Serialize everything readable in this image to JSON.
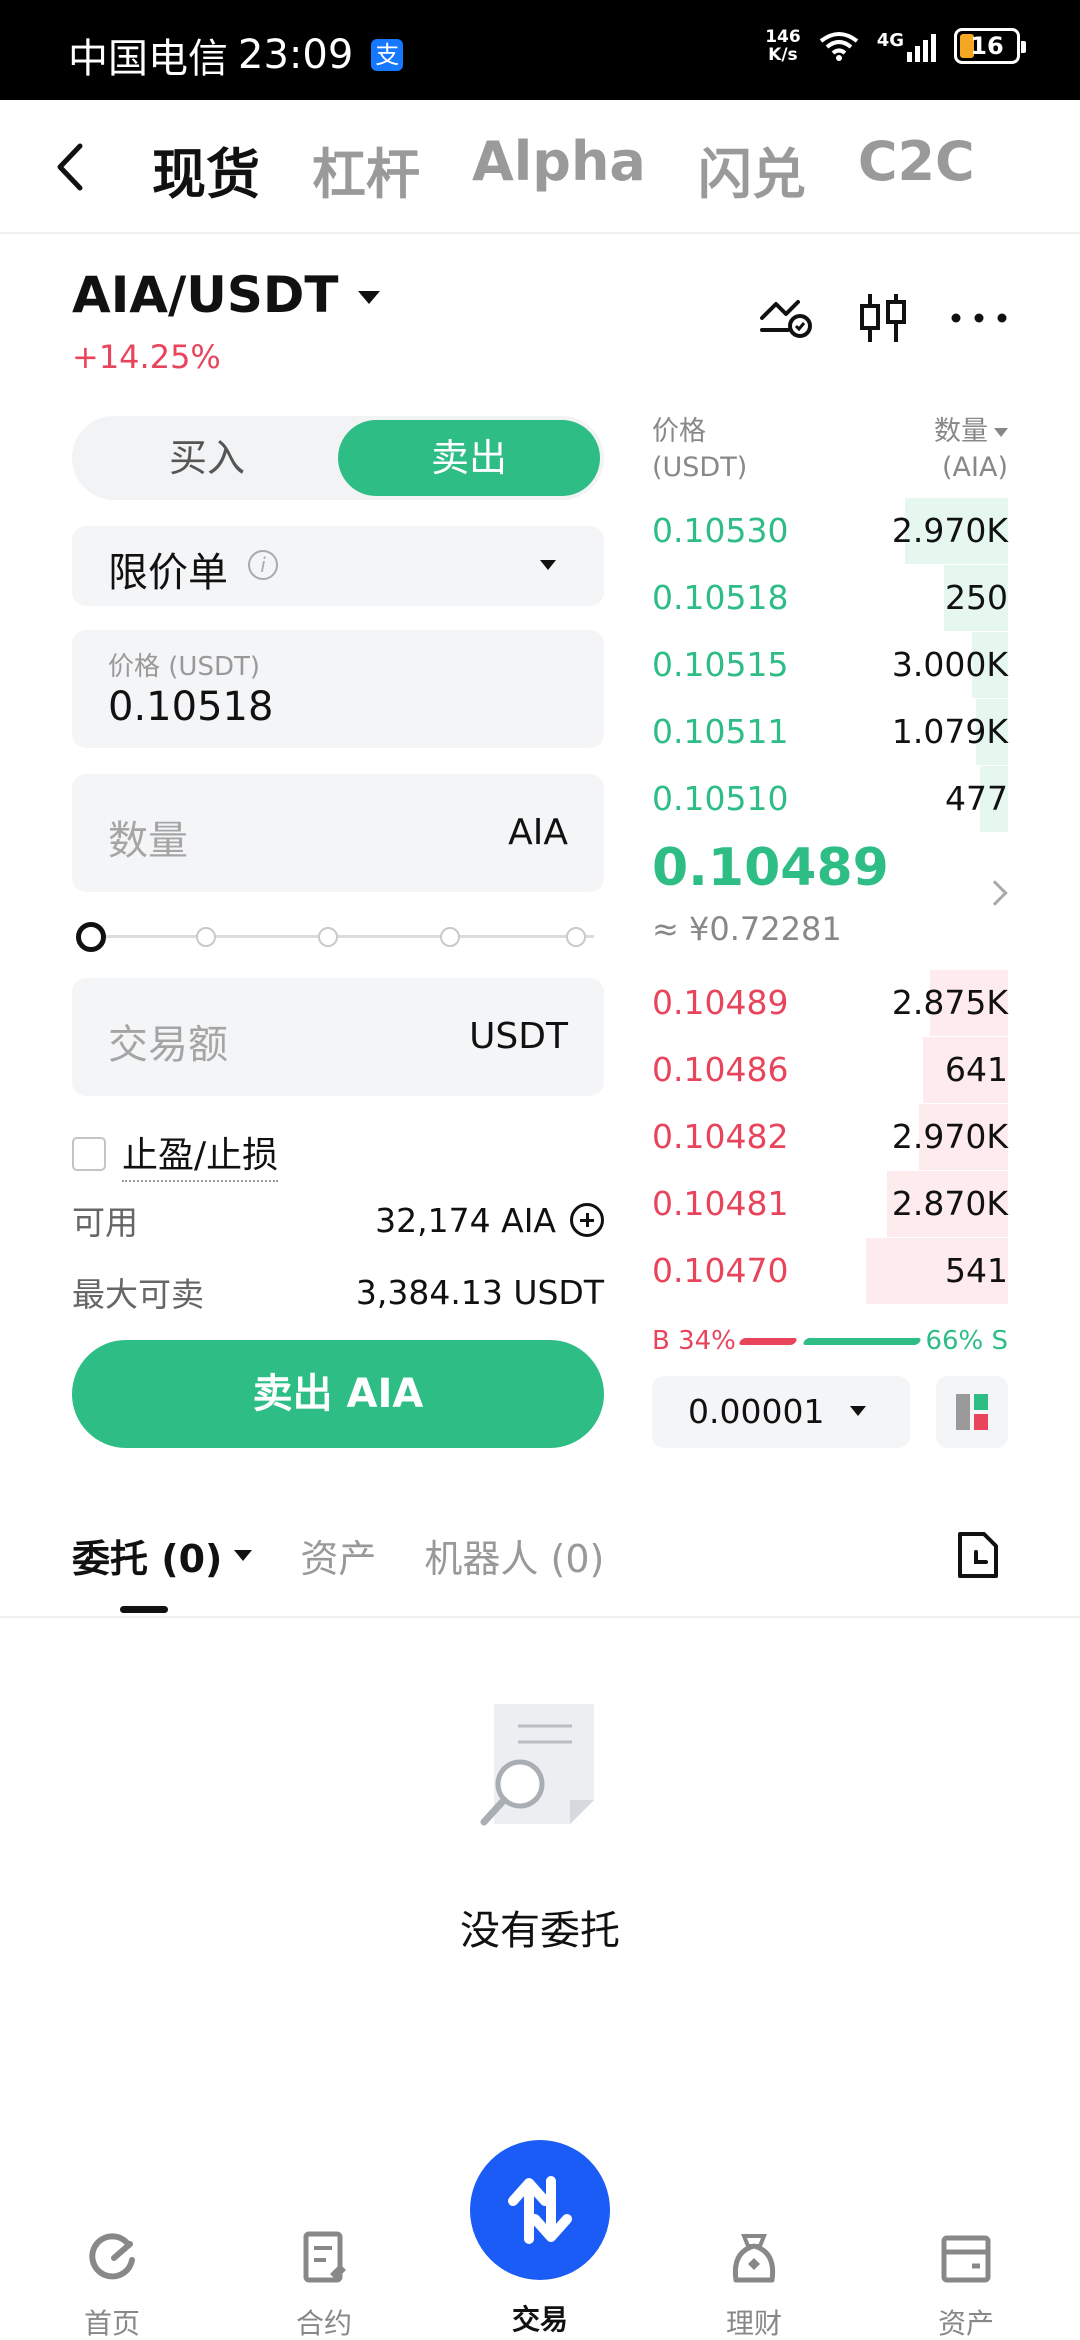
{
  "status_bar": {
    "carrier": "中国电信",
    "time": "23:09",
    "speed_value": "146",
    "speed_unit": "K/s",
    "network": "4G",
    "battery": "16"
  },
  "nav": {
    "tabs": [
      "现货",
      "杠杆",
      "Alpha",
      "闪兑",
      "C2C"
    ]
  },
  "pair": {
    "symbol": "AIA/USDT",
    "change": "+14.25%"
  },
  "trade": {
    "buy_label": "买入",
    "sell_label": "卖出",
    "order_type": "限价单",
    "price_label": "价格 (USDT)",
    "price_value": "0.10518",
    "qty_placeholder": "数量",
    "qty_unit": "AIA",
    "amount_placeholder": "交易额",
    "amount_unit": "USDT",
    "slider_percent": 0,
    "tpsl_label": "止盈/止损",
    "available_label": "可用",
    "available_value": "32,174 AIA",
    "max_sell_label": "最大可卖",
    "max_sell_value": "3,384.13 USDT",
    "submit_label": "卖出 AIA"
  },
  "order_book": {
    "price_header_1": "价格",
    "price_header_2": "(USDT)",
    "qty_header_1": "数量",
    "qty_header_2": "(AIA)",
    "asks": [
      {
        "price": "0.10530",
        "qty": "2.970K",
        "depth": 0.29
      },
      {
        "price": "0.10518",
        "qty": "250",
        "depth": 0.18
      },
      {
        "price": "0.10515",
        "qty": "3.000K",
        "depth": 0.1
      },
      {
        "price": "0.10511",
        "qty": "1.079K",
        "depth": 0.09
      },
      {
        "price": "0.10510",
        "qty": "477",
        "depth": 0.08
      }
    ],
    "last_price": "0.10489",
    "last_price_cny": "≈ ¥0.72281",
    "bids": [
      {
        "price": "0.10489",
        "qty": "2.875K",
        "depth": 0.22
      },
      {
        "price": "0.10486",
        "qty": "641",
        "depth": 0.24
      },
      {
        "price": "0.10482",
        "qty": "2.970K",
        "depth": 0.25
      },
      {
        "price": "0.10481",
        "qty": "2.870K",
        "depth": 0.34
      },
      {
        "price": "0.10470",
        "qty": "541",
        "depth": 0.4
      }
    ],
    "buy_ratio": "B 34%",
    "sell_ratio": "66% S",
    "precision": "0.00001"
  },
  "orders": {
    "tabs": [
      "委托 (0)",
      "资产",
      "机器人 (0)"
    ],
    "empty_text": "没有委托"
  },
  "bottom_nav": {
    "items": [
      "首页",
      "合约",
      "交易",
      "理财",
      "资产"
    ]
  },
  "colors": {
    "green": "#2ebd85",
    "red": "#e8455d",
    "blue": "#1a5cf5"
  }
}
